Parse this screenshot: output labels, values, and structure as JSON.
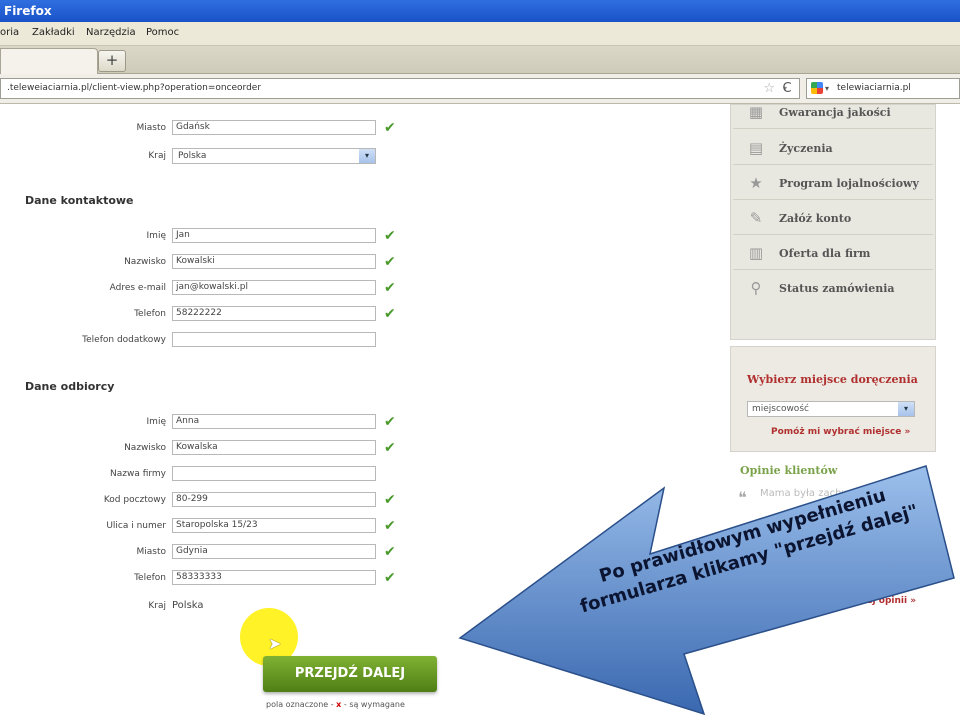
{
  "window": {
    "title": "Firefox"
  },
  "menu": [
    "oria",
    "Zakładki",
    "Narzędzia",
    "Pomoc"
  ],
  "tabs": {
    "new_tab": "+"
  },
  "navbar": {
    "url": ".teleweiaciarnia.pl/client-view.php?operation=onceorder",
    "star": "☆",
    "dropdown": "▾",
    "reload": "C",
    "search_text": "telewiaciarnia.pl"
  },
  "form": {
    "address_top": {
      "city_label": "Miasto",
      "city_value": "Gdańsk",
      "country_label": "Kraj",
      "country_value": "Polska"
    },
    "contact": {
      "heading": "Dane kontaktowe",
      "first_name_label": "Imię",
      "first_name": "Jan",
      "last_name_label": "Nazwisko",
      "last_name": "Kowalski",
      "email_label": "Adres e-mail",
      "email": "jan@kowalski.pl",
      "phone_label": "Telefon",
      "phone": "58222222",
      "phone2_label": "Telefon dodatkowy",
      "phone2": ""
    },
    "recipient": {
      "heading": "Dane odbiorcy",
      "first_name_label": "Imię",
      "first_name": "Anna",
      "last_name_label": "Nazwisko",
      "last_name": "Kowalska",
      "company_label": "Nazwa firmy",
      "company": "",
      "zip_label": "Kod pocztowy",
      "zip": "80-299",
      "street_label": "Ulica i numer",
      "street": "Staropolska 15/23",
      "city_label": "Miasto",
      "city": "Gdynia",
      "phone_label": "Telefon",
      "phone": "58333333",
      "country_label": "Kraj",
      "country": "Polska"
    },
    "check": "✔",
    "select_arrow": "▾",
    "submit_label": "PRZEJDŹ DALEJ",
    "required_note_pre": "pola oznaczone -",
    "required_mark": "x",
    "required_note_post": "- są wymagane"
  },
  "sidebar": {
    "items": [
      {
        "label": "Gwarancja jakości",
        "icon": "quality-icon"
      },
      {
        "label": "Życzenia",
        "icon": "document-icon"
      },
      {
        "label": "Program lojalnościowy",
        "icon": "star-icon"
      },
      {
        "label": "Załóż konto",
        "icon": "pen-icon"
      },
      {
        "label": "Oferta dla firm",
        "icon": "building-icon"
      },
      {
        "label": "Status zamówienia",
        "icon": "magnifier-icon"
      }
    ],
    "delivery": {
      "title": "Wybierz miejsce doręczenia",
      "placeholder": "miejscowość",
      "help_link": "Pomóż mi wybrać miejsce »"
    },
    "opinions": {
      "title": "Opinie klientów",
      "quote_mark": "❝",
      "text": "Mama była zachwycona...",
      "more": "Więcej opinii »"
    }
  },
  "callout": {
    "line1": "Po prawidłowym wypełnieniu",
    "line2": "formularza klikamy \"przejdź dalej\""
  },
  "colors": {
    "accent_green": "#5a8a1c",
    "link_red": "#b03030",
    "arrow_blue": "#5a86c8"
  }
}
